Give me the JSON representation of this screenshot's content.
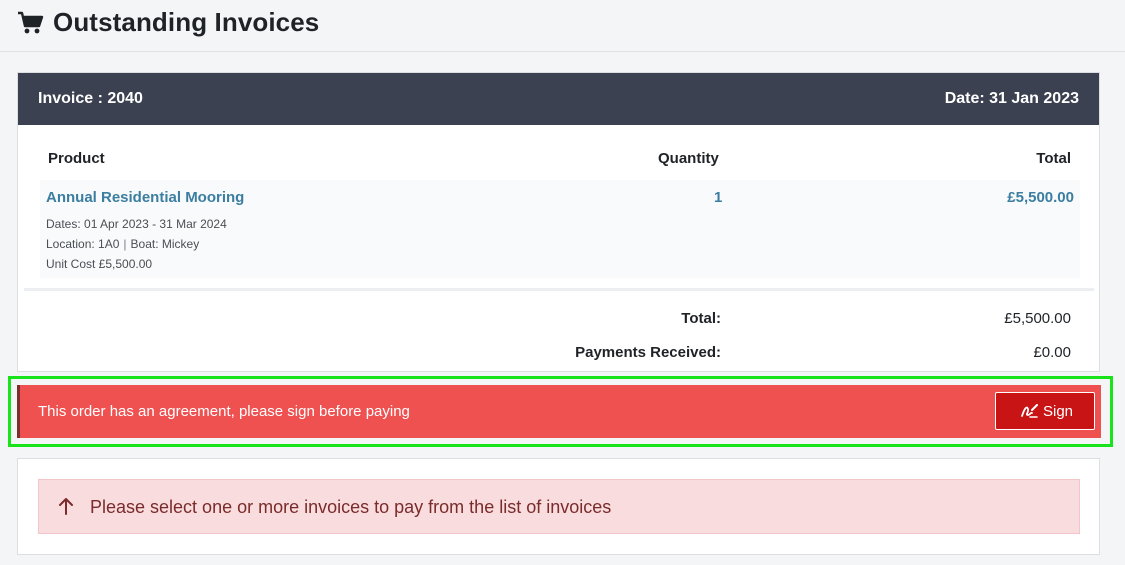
{
  "header": {
    "title": "Outstanding Invoices",
    "icon": "cart-icon"
  },
  "invoice": {
    "number_label": "Invoice : 2040",
    "date_label": "Date: 31 Jan 2023",
    "columns": {
      "product": "Product",
      "quantity": "Quantity",
      "total": "Total"
    },
    "line": {
      "name": "Annual Residential Mooring",
      "quantity": "1",
      "amount": "£5,500.00",
      "dates": "Dates: 01 Apr 2023 - 31 Mar 2024",
      "location": "Location: 1A0",
      "separator": "|",
      "boat": "Boat: Mickey",
      "unit_cost": "Unit Cost £5,500.00"
    },
    "summary": {
      "total_label": "Total:",
      "total_value": "£5,500.00",
      "payments_label": "Payments Received:",
      "payments_value": "£0.00"
    }
  },
  "agreement": {
    "message": "This order has an agreement, please sign before paying",
    "sign_label": "Sign",
    "sign_icon": "signature-pen-icon"
  },
  "notice": {
    "icon": "arrow-up-icon",
    "text": "Please select one or more invoices to pay from the list of invoices"
  },
  "colors": {
    "header_bg": "#3b4150",
    "link": "#3b7ea1",
    "alert_bg": "#ef5050",
    "button_bg": "#c81414",
    "notice_bg": "#f9dcdd",
    "highlight": "#19e31b"
  }
}
